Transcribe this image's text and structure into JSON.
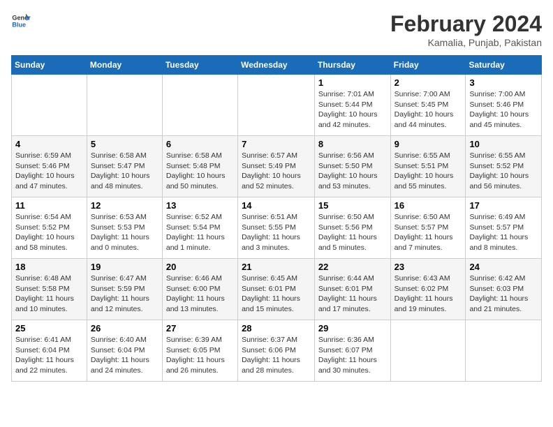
{
  "header": {
    "logo_line1": "General",
    "logo_line2": "Blue",
    "month_title": "February 2024",
    "subtitle": "Kamalia, Punjab, Pakistan"
  },
  "weekdays": [
    "Sunday",
    "Monday",
    "Tuesday",
    "Wednesday",
    "Thursday",
    "Friday",
    "Saturday"
  ],
  "weeks": [
    [
      {
        "day": "",
        "info": ""
      },
      {
        "day": "",
        "info": ""
      },
      {
        "day": "",
        "info": ""
      },
      {
        "day": "",
        "info": ""
      },
      {
        "day": "1",
        "info": "Sunrise: 7:01 AM\nSunset: 5:44 PM\nDaylight: 10 hours\nand 42 minutes."
      },
      {
        "day": "2",
        "info": "Sunrise: 7:00 AM\nSunset: 5:45 PM\nDaylight: 10 hours\nand 44 minutes."
      },
      {
        "day": "3",
        "info": "Sunrise: 7:00 AM\nSunset: 5:46 PM\nDaylight: 10 hours\nand 45 minutes."
      }
    ],
    [
      {
        "day": "4",
        "info": "Sunrise: 6:59 AM\nSunset: 5:46 PM\nDaylight: 10 hours\nand 47 minutes."
      },
      {
        "day": "5",
        "info": "Sunrise: 6:58 AM\nSunset: 5:47 PM\nDaylight: 10 hours\nand 48 minutes."
      },
      {
        "day": "6",
        "info": "Sunrise: 6:58 AM\nSunset: 5:48 PM\nDaylight: 10 hours\nand 50 minutes."
      },
      {
        "day": "7",
        "info": "Sunrise: 6:57 AM\nSunset: 5:49 PM\nDaylight: 10 hours\nand 52 minutes."
      },
      {
        "day": "8",
        "info": "Sunrise: 6:56 AM\nSunset: 5:50 PM\nDaylight: 10 hours\nand 53 minutes."
      },
      {
        "day": "9",
        "info": "Sunrise: 6:55 AM\nSunset: 5:51 PM\nDaylight: 10 hours\nand 55 minutes."
      },
      {
        "day": "10",
        "info": "Sunrise: 6:55 AM\nSunset: 5:52 PM\nDaylight: 10 hours\nand 56 minutes."
      }
    ],
    [
      {
        "day": "11",
        "info": "Sunrise: 6:54 AM\nSunset: 5:52 PM\nDaylight: 10 hours\nand 58 minutes."
      },
      {
        "day": "12",
        "info": "Sunrise: 6:53 AM\nSunset: 5:53 PM\nDaylight: 11 hours\nand 0 minutes."
      },
      {
        "day": "13",
        "info": "Sunrise: 6:52 AM\nSunset: 5:54 PM\nDaylight: 11 hours\nand 1 minute."
      },
      {
        "day": "14",
        "info": "Sunrise: 6:51 AM\nSunset: 5:55 PM\nDaylight: 11 hours\nand 3 minutes."
      },
      {
        "day": "15",
        "info": "Sunrise: 6:50 AM\nSunset: 5:56 PM\nDaylight: 11 hours\nand 5 minutes."
      },
      {
        "day": "16",
        "info": "Sunrise: 6:50 AM\nSunset: 5:57 PM\nDaylight: 11 hours\nand 7 minutes."
      },
      {
        "day": "17",
        "info": "Sunrise: 6:49 AM\nSunset: 5:57 PM\nDaylight: 11 hours\nand 8 minutes."
      }
    ],
    [
      {
        "day": "18",
        "info": "Sunrise: 6:48 AM\nSunset: 5:58 PM\nDaylight: 11 hours\nand 10 minutes."
      },
      {
        "day": "19",
        "info": "Sunrise: 6:47 AM\nSunset: 5:59 PM\nDaylight: 11 hours\nand 12 minutes."
      },
      {
        "day": "20",
        "info": "Sunrise: 6:46 AM\nSunset: 6:00 PM\nDaylight: 11 hours\nand 13 minutes."
      },
      {
        "day": "21",
        "info": "Sunrise: 6:45 AM\nSunset: 6:01 PM\nDaylight: 11 hours\nand 15 minutes."
      },
      {
        "day": "22",
        "info": "Sunrise: 6:44 AM\nSunset: 6:01 PM\nDaylight: 11 hours\nand 17 minutes."
      },
      {
        "day": "23",
        "info": "Sunrise: 6:43 AM\nSunset: 6:02 PM\nDaylight: 11 hours\nand 19 minutes."
      },
      {
        "day": "24",
        "info": "Sunrise: 6:42 AM\nSunset: 6:03 PM\nDaylight: 11 hours\nand 21 minutes."
      }
    ],
    [
      {
        "day": "25",
        "info": "Sunrise: 6:41 AM\nSunset: 6:04 PM\nDaylight: 11 hours\nand 22 minutes."
      },
      {
        "day": "26",
        "info": "Sunrise: 6:40 AM\nSunset: 6:04 PM\nDaylight: 11 hours\nand 24 minutes."
      },
      {
        "day": "27",
        "info": "Sunrise: 6:39 AM\nSunset: 6:05 PM\nDaylight: 11 hours\nand 26 minutes."
      },
      {
        "day": "28",
        "info": "Sunrise: 6:37 AM\nSunset: 6:06 PM\nDaylight: 11 hours\nand 28 minutes."
      },
      {
        "day": "29",
        "info": "Sunrise: 6:36 AM\nSunset: 6:07 PM\nDaylight: 11 hours\nand 30 minutes."
      },
      {
        "day": "",
        "info": ""
      },
      {
        "day": "",
        "info": ""
      }
    ]
  ]
}
